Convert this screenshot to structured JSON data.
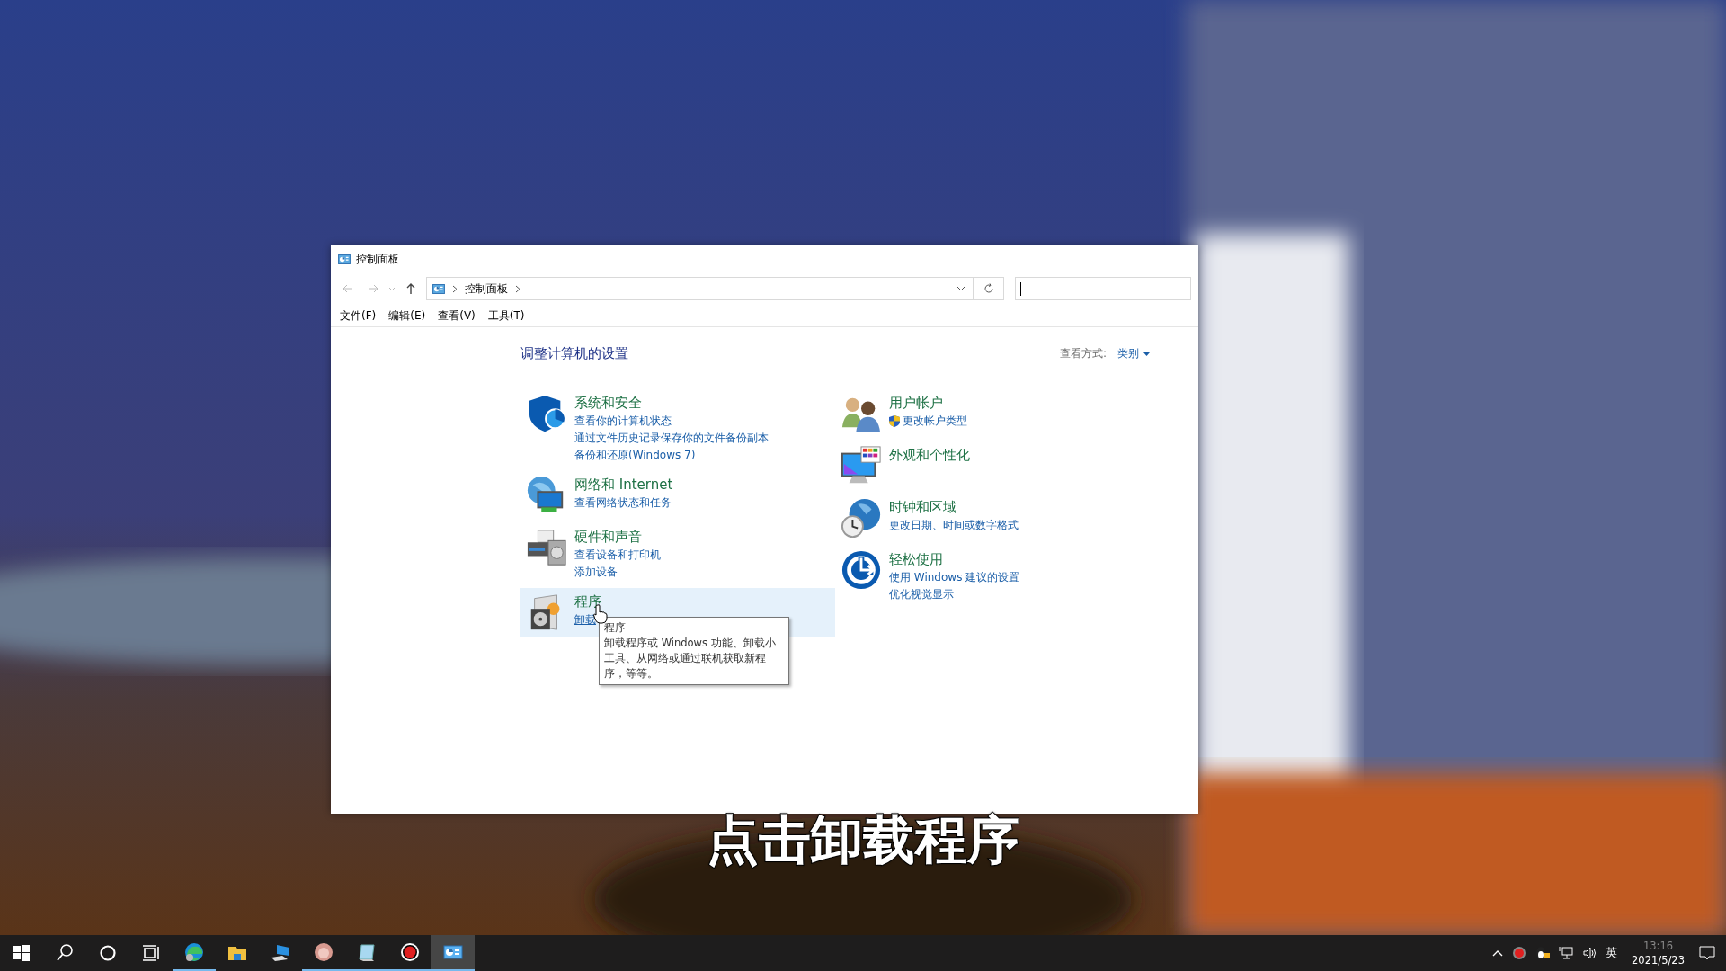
{
  "window": {
    "title": "控制面板"
  },
  "address_bar": {
    "breadcrumb": [
      "控制面板"
    ]
  },
  "search": {
    "focused": true
  },
  "menu": [
    "文件(F)",
    "编辑(E)",
    "查看(V)",
    "工具(T)"
  ],
  "heading": "调整计算机的设置",
  "view_by": {
    "label": "查看方式:",
    "value": "类别"
  },
  "columns": [
    {
      "categories": [
        {
          "kind": "security",
          "title": "系统和安全",
          "selected": false,
          "links": [
            {
              "text": "查看你的计算机状态",
              "kind": "plain"
            },
            {
              "text": "通过文件历史记录保存你的文件备份副本",
              "kind": "plain"
            },
            {
              "text": "备份和还原(Windows 7)",
              "kind": "plain"
            }
          ]
        },
        {
          "kind": "network",
          "title": "网络和 Internet",
          "selected": false,
          "links": [
            {
              "text": "查看网络状态和任务",
              "kind": "plain"
            }
          ]
        },
        {
          "kind": "hardware",
          "title": "硬件和声音",
          "selected": false,
          "links": [
            {
              "text": "查看设备和打印机",
              "kind": "plain"
            },
            {
              "text": "添加设备",
              "kind": "plain"
            }
          ]
        },
        {
          "kind": "programs",
          "title": "程序",
          "selected": true,
          "links": [
            {
              "text": "卸载",
              "kind": "plain"
            }
          ]
        }
      ]
    },
    {
      "categories": [
        {
          "kind": "users",
          "title": "用户帐户",
          "selected": false,
          "links": [
            {
              "text": "更改帐户类型",
              "kind": "admin"
            }
          ]
        },
        {
          "kind": "appearance",
          "title": "外观和个性化",
          "selected": false
        },
        {
          "kind": "clock",
          "title": "时钟和区域",
          "selected": false,
          "links": [
            {
              "text": "更改日期、时间或数字格式",
              "kind": "plain"
            }
          ]
        },
        {
          "kind": "ease",
          "title": "轻松使用",
          "selected": false,
          "links": [
            {
              "text": "使用 Windows 建议的设置",
              "kind": "plain"
            },
            {
              "text": "优化视觉显示",
              "kind": "plain"
            }
          ]
        }
      ]
    }
  ],
  "tooltip": {
    "title": "程序",
    "text": "卸载程序或 Windows 功能、卸载小工具、从网络或通过联机获取新程序，等等。"
  },
  "caption": "点击卸载程序",
  "taskbar": {
    "apps": [
      {
        "kind": "start",
        "open": false,
        "selected": false
      },
      {
        "kind": "search",
        "open": false,
        "selected": false
      },
      {
        "kind": "cortana",
        "open": false,
        "selected": false
      },
      {
        "kind": "taskview",
        "open": false,
        "selected": false
      },
      {
        "kind": "edge",
        "open": true,
        "selected": false
      },
      {
        "kind": "folder",
        "open": false,
        "selected": false
      },
      {
        "kind": "computer",
        "open": false,
        "selected": false
      },
      {
        "kind": "avatar",
        "open": true,
        "selected": false
      },
      {
        "kind": "notepad",
        "open": true,
        "selected": false
      },
      {
        "kind": "record",
        "open": true,
        "selected": false
      },
      {
        "kind": "controlpanel",
        "open": true,
        "selected": true
      }
    ],
    "ime": "英",
    "time": "13:16",
    "date": "2021/5/23"
  }
}
